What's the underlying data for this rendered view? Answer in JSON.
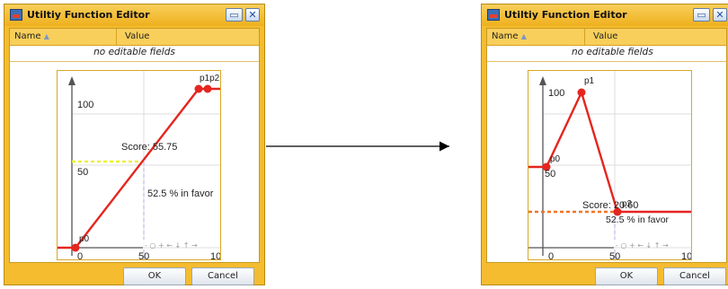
{
  "colors": {
    "window": "#f4bc2e",
    "curve": "#e5251f",
    "yellow_guide": "#f0ef36",
    "orange_guide": "#f27424"
  },
  "left": {
    "title": "Utiltiy Function Editor",
    "restore_glyph": "▭",
    "close_glyph": "✕",
    "col_name": "Name",
    "col_name_arrow": "▲",
    "col_value": "Value",
    "no_fields": "no editable fields",
    "score": "Score: 55.75",
    "favor": "52.5 % in favor",
    "y100": "100",
    "y50": "50",
    "x0": "0",
    "x50": "50",
    "x100": "10(",
    "p0": "p0",
    "p1p2": "p1p2",
    "nav_hint": "- ○ + ← ↓ ↑ →",
    "ok": "OK",
    "cancel": "Cancel"
  },
  "right": {
    "title": "Utiltiy Function Editor",
    "restore_glyph": "▭",
    "close_glyph": "✕",
    "col_name": "Name",
    "col_name_arrow": "▲",
    "col_value": "Value",
    "no_fields": "no editable fields",
    "score": "Score: 20.60",
    "favor": "52.5 % in favor",
    "y100": "100",
    "y50": "50",
    "x0": "0",
    "x50": "50",
    "x100": "10(",
    "p0": "p0",
    "p1": "p1",
    "p2": "p2",
    "nav_hint": "- ○ + ← ↓ ↑ →",
    "ok": "OK",
    "cancel": "Cancel"
  },
  "connector": {
    "icon": "arrow-right"
  }
}
